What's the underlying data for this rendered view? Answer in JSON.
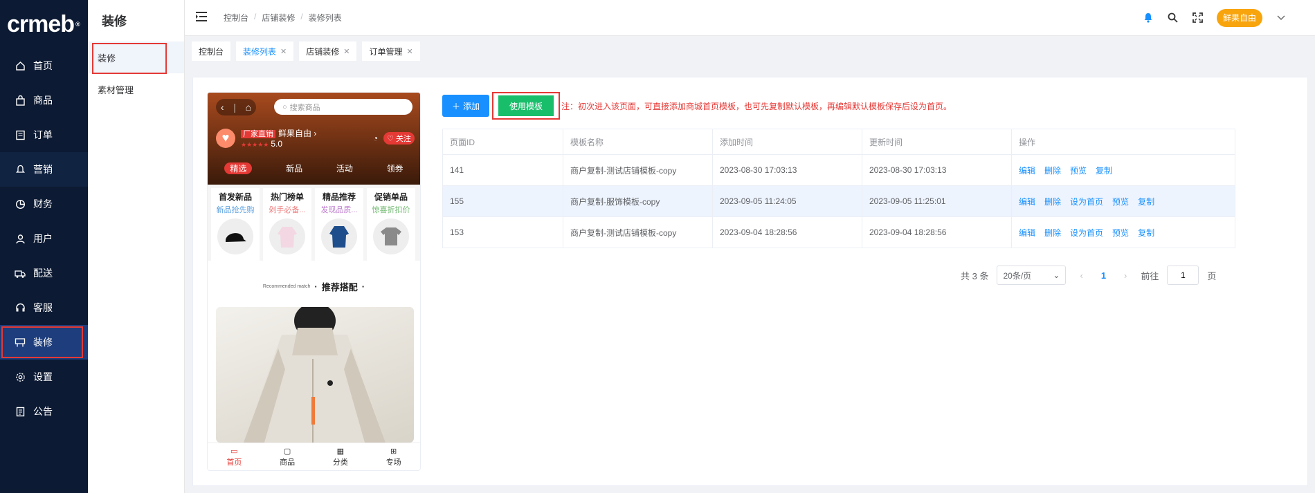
{
  "logo": {
    "text": "crmeb",
    "mark": "®"
  },
  "nav": {
    "items": [
      {
        "label": "首页",
        "icon": "home-icon"
      },
      {
        "label": "商品",
        "icon": "bag-icon"
      },
      {
        "label": "订单",
        "icon": "order-icon"
      },
      {
        "label": "营销",
        "icon": "bell-icon"
      },
      {
        "label": "财务",
        "icon": "pie-icon"
      },
      {
        "label": "用户",
        "icon": "user-icon"
      },
      {
        "label": "配送",
        "icon": "truck-icon"
      },
      {
        "label": "客服",
        "icon": "headset-icon"
      },
      {
        "label": "装修",
        "icon": "decor-icon"
      },
      {
        "label": "设置",
        "icon": "gear-icon"
      },
      {
        "label": "公告",
        "icon": "notice-icon"
      }
    ],
    "active": "装修"
  },
  "subnav": {
    "title": "装修",
    "items": [
      {
        "label": "装修"
      },
      {
        "label": "素材管理"
      }
    ]
  },
  "header": {
    "breadcrumb": [
      "控制台",
      "店铺装修",
      "装修列表"
    ],
    "username": "鲜果自由"
  },
  "tags": [
    {
      "label": "控制台",
      "closable": false
    },
    {
      "label": "装修列表",
      "closable": true
    },
    {
      "label": "店铺装修",
      "closable": true
    },
    {
      "label": "订单管理",
      "closable": true
    }
  ],
  "preview": {
    "search_placeholder": "搜索商品",
    "store_badge": "厂家直销",
    "store_name": "鲜果自由",
    "rating": "5.0",
    "follow_label": "关注",
    "tabs": [
      "精选",
      "新品",
      "活动",
      "领券"
    ],
    "categories": [
      {
        "title": "首发新品",
        "sub": "新品抢先购",
        "color": "#5aa0e0"
      },
      {
        "title": "热门榜单",
        "sub": "剁手必备...",
        "color": "#f08080"
      },
      {
        "title": "精品推荐",
        "sub": "发现品质...",
        "color": "#c080d0"
      },
      {
        "title": "促销单品",
        "sub": "惊喜折扣价",
        "color": "#70b870"
      }
    ],
    "rec_small": "Recommended match",
    "rec_title": "推荐搭配",
    "tabbar": [
      "首页",
      "商品",
      "分类",
      "专场"
    ]
  },
  "toolbar": {
    "add_label": "添加",
    "use_template_label": "使用模板",
    "notice": "注：初次进入该页面，可直接添加商城首页模板，也可先复制默认模板，再编辑默认模板保存后设为首页。"
  },
  "table": {
    "headers": [
      "页面ID",
      "模板名称",
      "添加时间",
      "更新时间",
      "操作"
    ],
    "rows": [
      {
        "id": "141",
        "name": "商户复制-测试店铺模板-copy",
        "created": "2023-08-30 17:03:13",
        "updated": "2023-08-30 17:03:13",
        "ops": [
          "编辑",
          "删除",
          "预览",
          "复制"
        ]
      },
      {
        "id": "155",
        "name": "商户复制-服饰模板-copy",
        "created": "2023-09-05 11:24:05",
        "updated": "2023-09-05 11:25:01",
        "ops": [
          "编辑",
          "删除",
          "设为首页",
          "预览",
          "复制"
        ]
      },
      {
        "id": "153",
        "name": "商户复制-测试店铺模板-copy",
        "created": "2023-09-04 18:28:56",
        "updated": "2023-09-04 18:28:56",
        "ops": [
          "编辑",
          "删除",
          "设为首页",
          "预览",
          "复制"
        ]
      }
    ]
  },
  "pagination": {
    "total_text": "共 3 条",
    "page_size": "20条/页",
    "current_page": "1",
    "goto_label": "前往",
    "goto_value": "1",
    "page_suffix": "页"
  },
  "colors": {
    "accent": "#1890ff",
    "success": "#19be6b",
    "danger": "#e53935",
    "sidebar": "#0c1a33",
    "badge": "#f8a40c"
  }
}
